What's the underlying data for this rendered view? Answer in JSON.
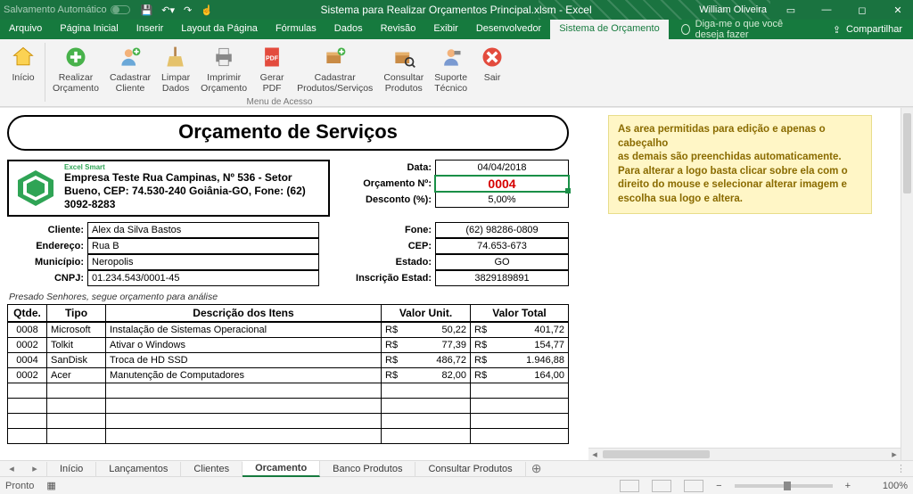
{
  "titlebar": {
    "autosave": "Salvamento Automático",
    "doc_title": "Sistema para Realizar Orçamentos Principal.xlsm  -  Excel",
    "user": "William Oliveira"
  },
  "menu": {
    "file": "Arquivo",
    "home": "Página Inicial",
    "insert": "Inserir",
    "layout": "Layout da Página",
    "formulas": "Fórmulas",
    "data": "Dados",
    "review": "Revisão",
    "view": "Exibir",
    "developer": "Desenvolvedor",
    "custom": "Sistema de Orçamento",
    "tellme": "Diga-me o que você deseja fazer",
    "share": "Compartilhar"
  },
  "ribbon": {
    "group_label": "Menu de Acesso",
    "inicio": "Início",
    "realizar": "Realizar\nOrçamento",
    "cadastrar_cliente": "Cadastrar\nCliente",
    "limpar": "Limpar\nDados",
    "imprimir": "Imprimir\nOrçamento",
    "gerar_pdf": "Gerar\nPDF",
    "cadastrar_prod": "Cadastrar\nProdutos/Serviços",
    "consultar_prod": "Consultar\nProdutos",
    "suporte": "Suporte\nTécnico",
    "sair": "Sair"
  },
  "doc": {
    "title": "Orçamento de Serviços",
    "logo_label": "Excel Smart",
    "company": "Empresa Teste Rua Campinas, Nº 536 - Setor Bueno, CEP: 74.530-240 Goiânia-GO, Fone: (62) 3092-8283",
    "header": {
      "data_k": "Data:",
      "data_v": "04/04/2018",
      "orc_k": "Orçamento Nº:",
      "orc_v": "0004",
      "desc_k": "Desconto (%):",
      "desc_v": "5,00%"
    },
    "client": {
      "cliente_k": "Cliente:",
      "cliente_v": "Alex da Silva Bastos",
      "end_k": "Endereço:",
      "end_v": "Rua B",
      "mun_k": "Município:",
      "mun_v": "Neropolis",
      "cnpj_k": "CNPJ:",
      "cnpj_v": "01.234.543/0001-45",
      "fone_k": "Fone:",
      "fone_v": "(62) 98286-0809",
      "cep_k": "CEP:",
      "cep_v": "74.653-673",
      "estado_k": "Estado:",
      "estado_v": "GO",
      "insc_k": "Inscrição Estad:",
      "insc_v": "3829189891"
    },
    "note": "Presado Senhores, segue orçamento para análise",
    "cols": {
      "qtde": "Qtde.",
      "tipo": "Tipo",
      "desc": "Descrição dos Itens",
      "unit": "Valor Unit.",
      "total": "Valor Total"
    },
    "currency": "R$",
    "rows": [
      {
        "q": "0008",
        "t": "Microsoft",
        "d": "Instalação de Sistemas Operacional",
        "u": "50,22",
        "tot": "401,72"
      },
      {
        "q": "0002",
        "t": "Tolkit",
        "d": "Ativar o Windows",
        "u": "77,39",
        "tot": "154,77"
      },
      {
        "q": "0004",
        "t": "SanDisk",
        "d": "Troca de HD SSD",
        "u": "486,72",
        "tot": "1.946,88"
      },
      {
        "q": "0002",
        "t": "Acer",
        "d": "Manutenção de Computadores",
        "u": "82,00",
        "tot": "164,00"
      }
    ]
  },
  "side_note": "As area permitidas para edição e apenas o cabeçalho\nas demais são preenchidas automaticamente. Para alterar a logo basta clicar sobre ela com o direito do mouse e selecionar alterar imagem e escolha sua logo e altera.",
  "sheets": {
    "s1": "Início",
    "s2": "Lançamentos",
    "s3": "Clientes",
    "s4": "Orcamento",
    "s5": "Banco Produtos",
    "s6": "Consultar Produtos"
  },
  "status": {
    "ready": "Pronto",
    "zoom": "100%"
  }
}
